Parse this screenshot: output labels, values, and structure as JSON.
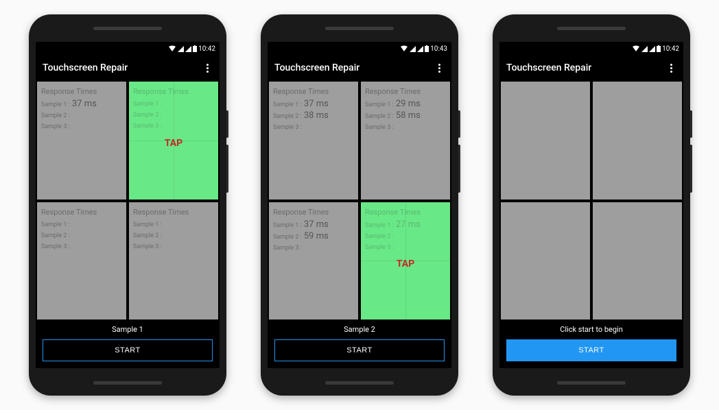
{
  "status": {
    "time": "10:42",
    "time2": "10:43",
    "time3": "10:42"
  },
  "app": {
    "title": "Touchscreen Repair"
  },
  "labels": {
    "quad_title": "Response Times",
    "sample1": "Sample 1 :",
    "sample2": "Sample 2 :",
    "sample3": "Sample 3 :",
    "tap": "TAP",
    "start": "START"
  },
  "phone1": {
    "footer": "Sample 1",
    "quads": [
      {
        "active": false,
        "s1": "37 ms",
        "s2": "",
        "s3": ""
      },
      {
        "active": true,
        "s1": "",
        "s2": "",
        "s3": "",
        "tap": true
      },
      {
        "active": false,
        "s1": "",
        "s2": "",
        "s3": ""
      },
      {
        "active": false,
        "s1": "",
        "s2": "",
        "s3": ""
      }
    ]
  },
  "phone2": {
    "footer": "Sample 2",
    "quads": [
      {
        "active": false,
        "s1": "37 ms",
        "s2": "38 ms",
        "s3": ""
      },
      {
        "active": false,
        "s1": "29 ms",
        "s2": "58 ms",
        "s3": ""
      },
      {
        "active": false,
        "s1": "37 ms",
        "s2": "59 ms",
        "s3": ""
      },
      {
        "active": true,
        "s1": "27 ms",
        "s2": "",
        "s3": "",
        "tap": true
      }
    ]
  },
  "phone3": {
    "footer": "Click start to begin",
    "quads": [
      {
        "empty": true
      },
      {
        "empty": true
      },
      {
        "empty": true
      },
      {
        "empty": true
      }
    ]
  }
}
